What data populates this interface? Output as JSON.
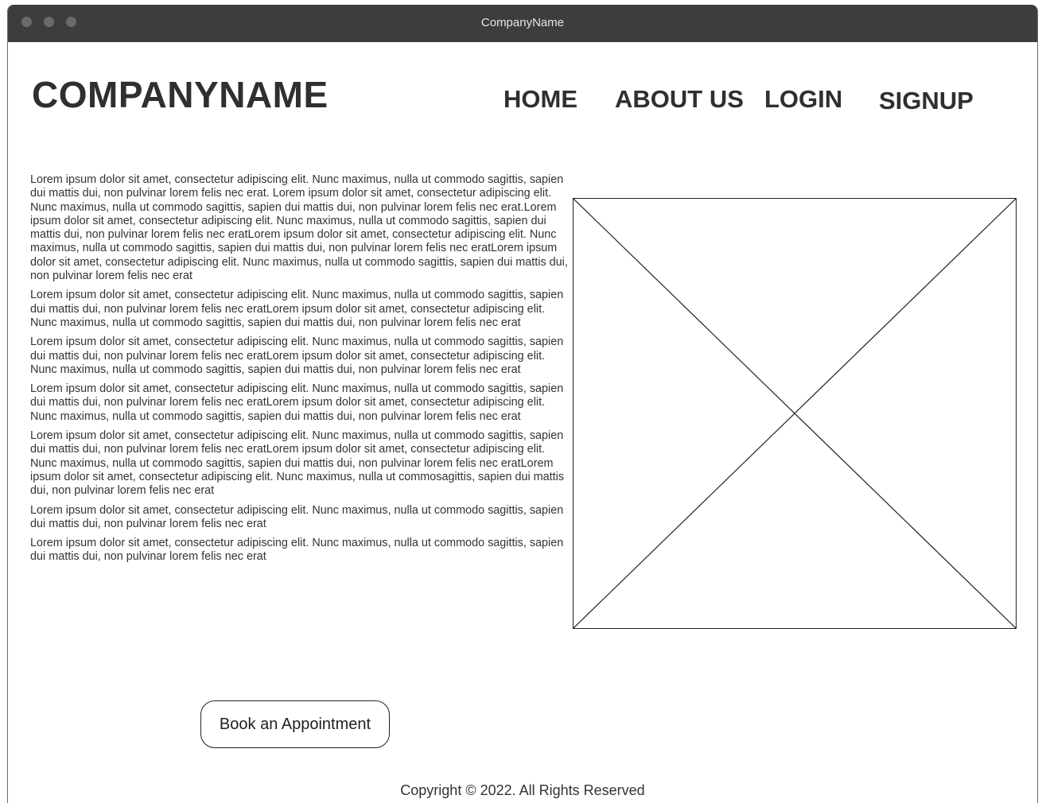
{
  "window": {
    "title": "CompanyName"
  },
  "header": {
    "logo": "COMPANYNAME",
    "nav": [
      {
        "label": "HOME"
      },
      {
        "label": "ABOUT US"
      },
      {
        "label": "LOGIN"
      },
      {
        "label": "SIGNUP"
      }
    ]
  },
  "main": {
    "paragraphs": [
      "Lorem ipsum dolor sit amet, consectetur adipiscing elit. Nunc maximus, nulla ut commodo sagittis, sapien dui mattis dui, non pulvinar lorem felis nec erat. Lorem ipsum dolor sit amet, consectetur adipiscing elit. Nunc maximus, nulla ut commodo sagittis, sapien dui mattis dui, non pulvinar lorem felis nec erat.Lorem ipsum dolor sit amet, consectetur adipiscing elit. Nunc maximus, nulla ut commodo sagittis, sapien dui mattis dui, non pulvinar lorem felis nec eratLorem ipsum dolor sit amet, consectetur adipiscing elit. Nunc maximus, nulla ut commodo sagittis, sapien dui mattis dui, non pulvinar lorem felis nec eratLorem ipsum dolor sit amet, consectetur adipiscing elit. Nunc maximus, nulla ut commodo sagittis, sapien dui mattis dui, non pulvinar lorem felis nec erat",
      "Lorem ipsum dolor sit amet, consectetur adipiscing elit. Nunc maximus, nulla ut commodo sagittis, sapien dui mattis dui, non pulvinar lorem felis nec eratLorem ipsum dolor sit amet, consectetur adipiscing elit. Nunc maximus, nulla ut commodo sagittis, sapien dui mattis dui, non pulvinar lorem felis nec erat",
      "Lorem ipsum dolor sit amet, consectetur adipiscing elit. Nunc maximus, nulla ut commodo sagittis, sapien dui mattis dui, non pulvinar lorem felis nec eratLorem ipsum dolor sit amet, consectetur adipiscing elit. Nunc maximus, nulla ut commodo sagittis, sapien dui mattis dui, non pulvinar lorem felis nec erat",
      "Lorem ipsum dolor sit amet, consectetur adipiscing elit. Nunc maximus, nulla ut commodo sagittis, sapien dui mattis dui, non pulvinar lorem felis nec eratLorem ipsum dolor sit amet, consectetur adipiscing elit. Nunc maximus, nulla ut commodo sagittis, sapien dui mattis dui, non pulvinar lorem felis nec erat",
      "Lorem ipsum dolor sit amet, consectetur adipiscing elit. Nunc maximus, nulla ut commodo sagittis, sapien dui mattis dui, non pulvinar lorem felis nec eratLorem ipsum dolor sit amet, consectetur adipiscing elit. Nunc maximus, nulla ut commodo sagittis, sapien dui mattis dui, non pulvinar lorem felis nec eratLorem ipsum dolor sit amet, consectetur adipiscing elit. Nunc maximus, nulla ut commosagittis, sapien dui mattis dui, non pulvinar lorem felis nec erat",
      "Lorem ipsum dolor sit amet, consectetur adipiscing elit. Nunc maximus, nulla ut commodo sagittis, sapien dui mattis dui, non pulvinar lorem felis nec erat",
      "Lorem ipsum dolor sit amet, consectetur adipiscing elit. Nunc maximus, nulla ut commodo sagittis, sapien dui mattis dui, non pulvinar lorem felis nec erat"
    ],
    "cta_label": "Book an Appointment"
  },
  "footer": {
    "copyright": "Copyright  © 2022. All Rights Reserved"
  }
}
